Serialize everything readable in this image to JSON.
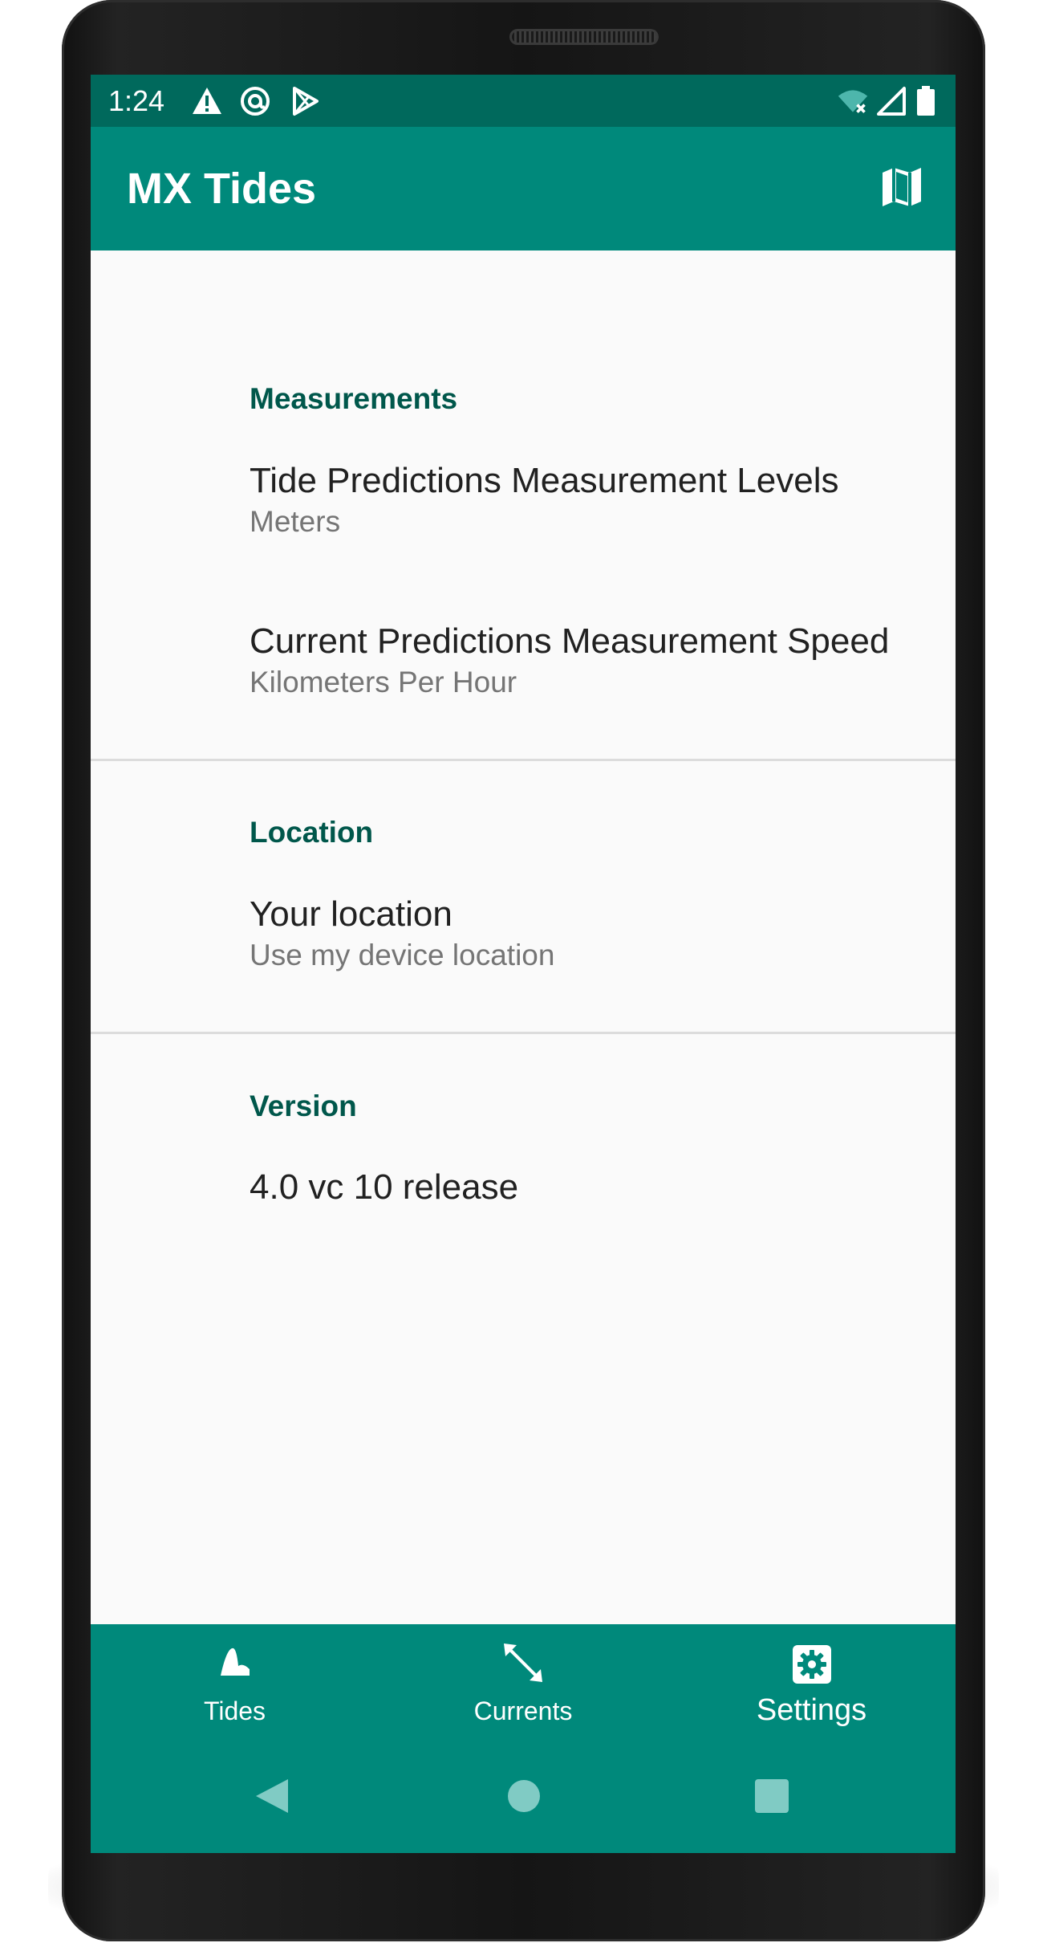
{
  "status_bar": {
    "time": "1:24",
    "left_icons": [
      "warning-icon",
      "at-sign-icon",
      "play-store-icon"
    ],
    "right_icons": [
      "wifi-off-icon",
      "cell-signal-icon",
      "battery-icon"
    ]
  },
  "app_bar": {
    "title": "MX Tides",
    "action_icon": "map-icon"
  },
  "settings": {
    "measurements": {
      "header": "Measurements",
      "tide_levels": {
        "title": "Tide Predictions Measurement Levels",
        "summary": "Meters"
      },
      "current_speed": {
        "title": "Current Predictions Measurement Speed",
        "summary": "Kilometers Per Hour"
      }
    },
    "location": {
      "header": "Location",
      "your_location": {
        "title": "Your location",
        "summary": "Use my device location"
      }
    },
    "version": {
      "header": "Version",
      "value": "4.0 vc 10 release"
    }
  },
  "bottom_nav": {
    "items": [
      {
        "label": "Tides",
        "icon": "tide-icon",
        "selected": false
      },
      {
        "label": "Currents",
        "icon": "currents-arrows-icon",
        "selected": false
      },
      {
        "label": "Settings",
        "icon": "gear-icon",
        "selected": true
      }
    ]
  },
  "system_nav": {
    "buttons": [
      "back-icon",
      "home-icon",
      "recents-icon"
    ]
  },
  "colors": {
    "status_bar": "#00695c",
    "primary": "#00897b",
    "section_header": "#00574b",
    "background": "#fafafa"
  }
}
